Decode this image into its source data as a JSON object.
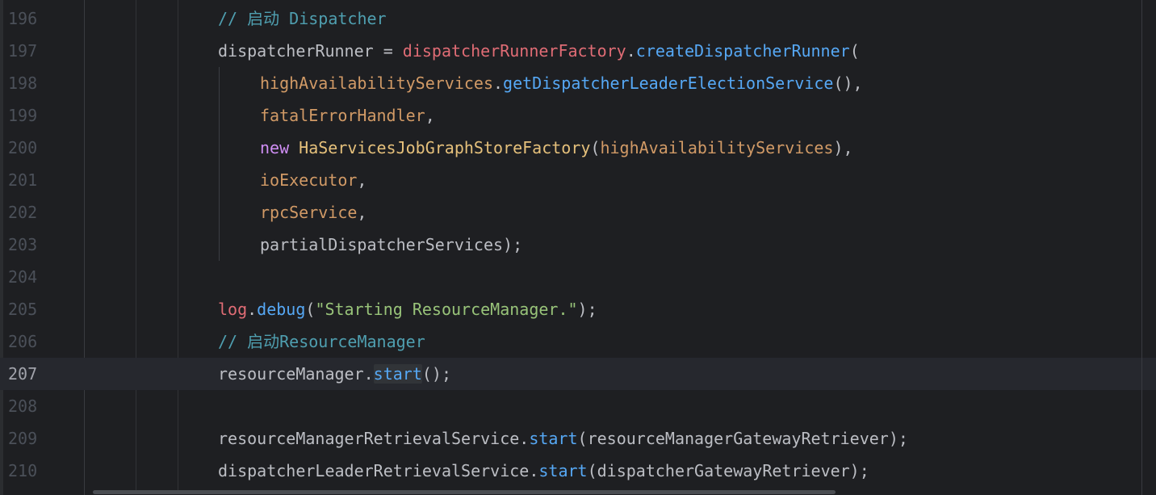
{
  "editor": {
    "current_line": "207",
    "lines": [
      {
        "num": "196",
        "tokens": [
          [
            "cmt",
            "// 启动 Dispatcher"
          ]
        ]
      },
      {
        "num": "197",
        "tokens": [
          [
            "pl",
            "dispatcherRunner = "
          ],
          [
            "pink",
            "dispatcherRunnerFactory"
          ],
          [
            "pl",
            "."
          ],
          [
            "fn",
            "createDispatcherRunner"
          ],
          [
            "pl",
            "("
          ]
        ]
      },
      {
        "num": "198",
        "tokens": [
          [
            "ifld",
            "highAvailabilityServices"
          ],
          [
            "pl",
            "."
          ],
          [
            "fn",
            "getDispatcherLeaderElectionService"
          ],
          [
            "pl",
            "(),"
          ]
        ]
      },
      {
        "num": "199",
        "tokens": [
          [
            "ifld",
            "fatalErrorHandler"
          ],
          [
            "pl",
            ","
          ]
        ]
      },
      {
        "num": "200",
        "tokens": [
          [
            "kw",
            "new "
          ],
          [
            "cls",
            "HaServicesJobGraphStoreFactory"
          ],
          [
            "pl",
            "("
          ],
          [
            "ifld",
            "highAvailabilityServices"
          ],
          [
            "pl",
            "),"
          ]
        ]
      },
      {
        "num": "201",
        "tokens": [
          [
            "ifld",
            "ioExecutor"
          ],
          [
            "pl",
            ","
          ]
        ]
      },
      {
        "num": "202",
        "tokens": [
          [
            "ifld",
            "rpcService"
          ],
          [
            "pl",
            ","
          ]
        ]
      },
      {
        "num": "203",
        "tokens": [
          [
            "pl",
            "partialDispatcherServices);"
          ]
        ]
      },
      {
        "num": "204",
        "tokens": []
      },
      {
        "num": "205",
        "tokens": [
          [
            "pink",
            "log"
          ],
          [
            "pl",
            "."
          ],
          [
            "fn",
            "debug"
          ],
          [
            "pl",
            "("
          ],
          [
            "str",
            "\"Starting ResourceManager.\""
          ],
          [
            "pl",
            ");"
          ]
        ]
      },
      {
        "num": "206",
        "tokens": [
          [
            "cmt",
            "// 启动ResourceManager"
          ]
        ]
      },
      {
        "num": "207",
        "tokens": [
          [
            "pl",
            "resourceManager."
          ],
          [
            "fn hl-start",
            "start"
          ],
          [
            "pl",
            "();"
          ]
        ]
      },
      {
        "num": "208",
        "tokens": []
      },
      {
        "num": "209",
        "tokens": [
          [
            "pl",
            "resourceManagerRetrievalService."
          ],
          [
            "fn",
            "start"
          ],
          [
            "pl",
            "(resourceManagerGatewayRetriever);"
          ]
        ]
      },
      {
        "num": "210",
        "tokens": [
          [
            "pl",
            "dispatcherLeaderRetrievalService."
          ],
          [
            "fn",
            "start"
          ],
          [
            "pl",
            "(dispatcherGatewayRetriever);"
          ]
        ]
      }
    ],
    "indented_lines": [
      "198",
      "199",
      "200",
      "201",
      "202",
      "203"
    ]
  }
}
